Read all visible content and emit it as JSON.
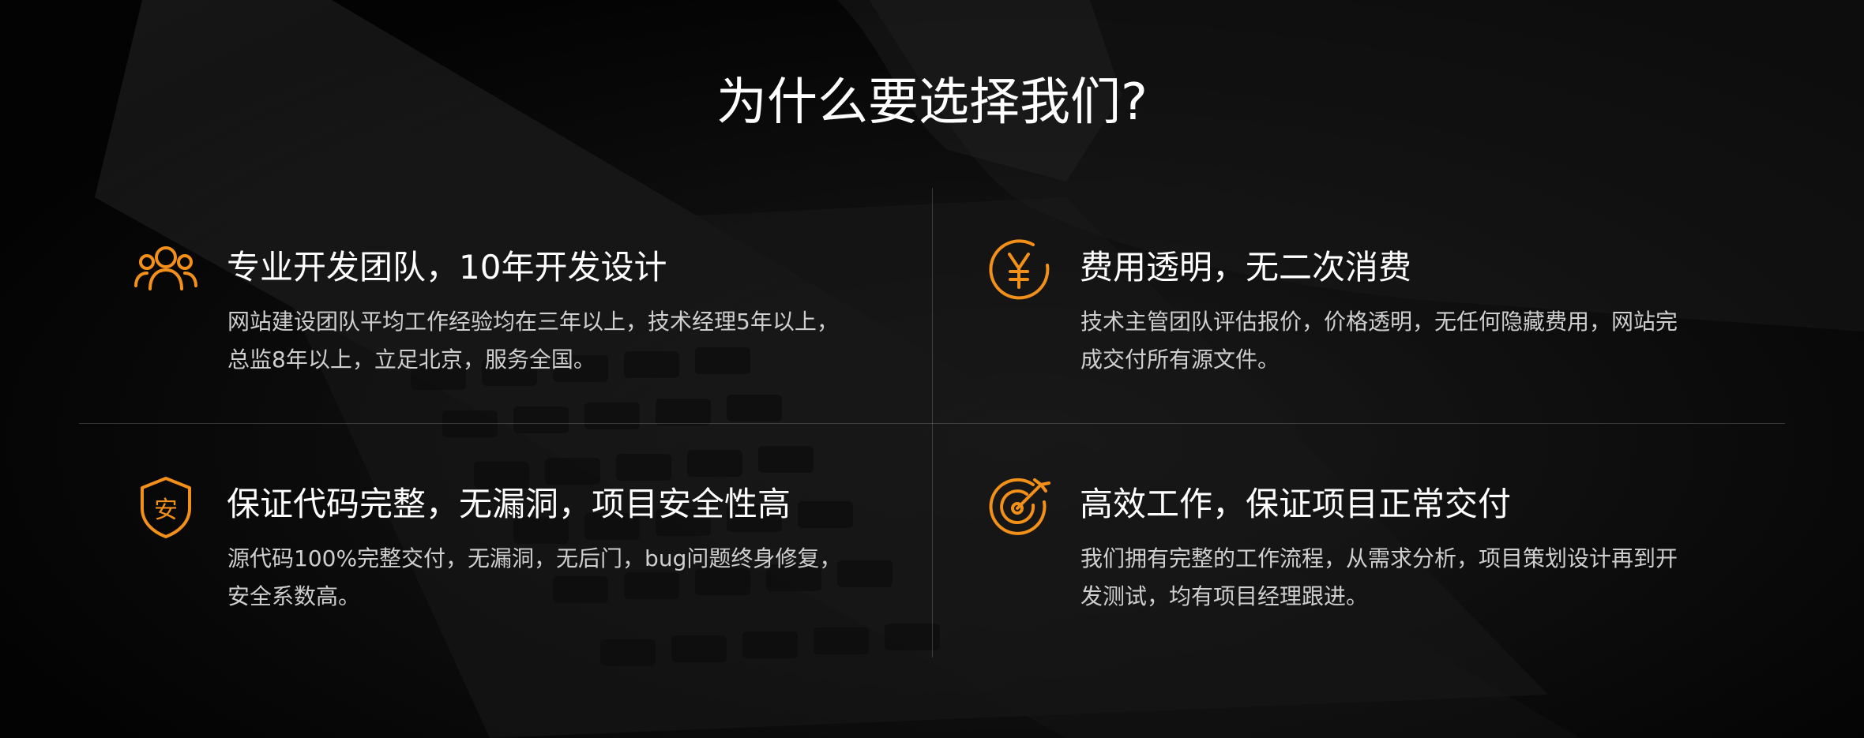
{
  "section": {
    "title": "为什么要选择我们?"
  },
  "colors": {
    "accent": "#f39019",
    "background": "#000000",
    "title_text": "#ffffff",
    "body_text": "#cfcfcf"
  },
  "features": [
    {
      "icon": "team-icon",
      "title": "专业开发团队，10年开发设计",
      "description": "网站建设团队平均工作经验均在三年以上，技术经理5年以上，总监8年以上，立足北京，服务全国。"
    },
    {
      "icon": "yen-icon",
      "title": "费用透明，无二次消费",
      "description": "技术主管团队评估报价，价格透明，无任何隐藏费用，网站完成交付所有源文件。"
    },
    {
      "icon": "shield-icon",
      "icon_text": "安",
      "title": "保证代码完整，无漏洞，项目安全性高",
      "description": "源代码100%完整交付，无漏洞，无后门，bug问题终身修复，安全系数高。"
    },
    {
      "icon": "target-icon",
      "title": "高效工作，保证项目正常交付",
      "description": "我们拥有完整的工作流程，从需求分析，项目策划设计再到开发测试，均有项目经理跟进。"
    }
  ]
}
